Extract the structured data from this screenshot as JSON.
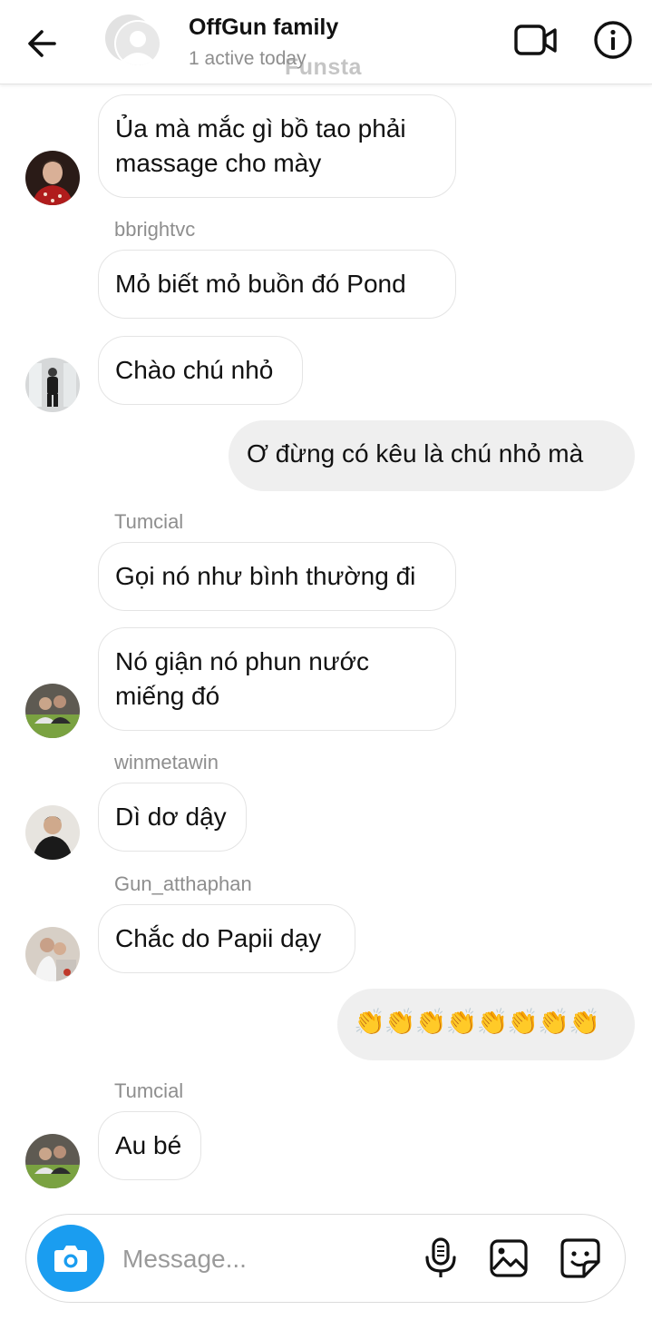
{
  "header": {
    "title": "OffGun family",
    "status": "1 active today",
    "watermark": "Funsta"
  },
  "messages": [
    {
      "side": "in",
      "sender": "",
      "text": "Ủa mà mắc gì bồ tao phải massage cho mày"
    },
    {
      "side": "in",
      "sender": "bbrightvc",
      "text": "Mỏ biết mỏ buồn đó Pond"
    },
    {
      "side": "in",
      "sender": "",
      "text": "Chào chú nhỏ"
    },
    {
      "side": "out",
      "sender": "",
      "text": "Ơ đừng có kêu là chú nhỏ mà"
    },
    {
      "side": "in",
      "sender": "Tumcial",
      "text": "Gọi nó như bình thường đi"
    },
    {
      "side": "in",
      "sender": "",
      "text": "Nó giận nó phun nước miếng đó"
    },
    {
      "side": "in",
      "sender": "winmetawin",
      "text": "Dì dơ dậy"
    },
    {
      "side": "in",
      "sender": "Gun_atthaphan",
      "text": "Chắc do Papii dạy"
    },
    {
      "side": "out",
      "sender": "",
      "text": "👏👏👏👏👏👏👏👏"
    },
    {
      "side": "in",
      "sender": "Tumcial",
      "text": "Au bé"
    }
  ],
  "composer": {
    "placeholder": "Message..."
  },
  "colors": {
    "camera_button": "#1a9df0",
    "outgoing_bubble": "#efefef",
    "incoming_border": "#e4e4e4",
    "sender_text": "#8e8e8e"
  },
  "icons": [
    "back-arrow-icon",
    "video-call-icon",
    "info-icon",
    "camera-icon",
    "microphone-icon",
    "image-icon",
    "sticker-icon"
  ]
}
